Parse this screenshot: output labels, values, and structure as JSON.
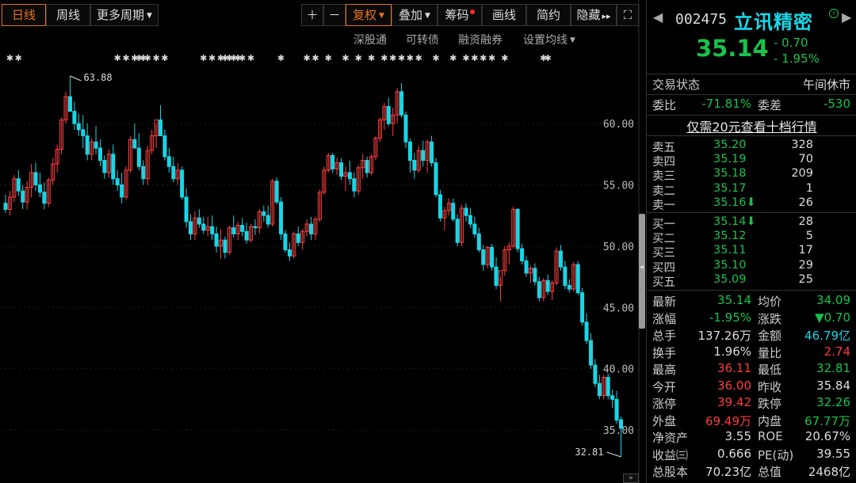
{
  "toolbar": {
    "period_day": "日线",
    "period_week": "周线",
    "period_more": "更多周期",
    "zoom_in": "＋",
    "zoom_out": "－",
    "adjust": "复权",
    "overlay": "叠加",
    "chips": "筹码",
    "draw": "画线",
    "simple": "简约",
    "hide": "隐藏",
    "hide_arrows": "▸▸",
    "fullscreen": "⛶"
  },
  "subbar": {
    "sz_connect": "深股通",
    "convertible": "可转债",
    "margin": "融资融券",
    "ma_settings": "设置均线"
  },
  "chart_data": {
    "type": "candlestick",
    "y_ticks": [
      "60.00",
      "55.00",
      "50.00",
      "45.00",
      "40.00",
      "35.00"
    ],
    "ylim": [
      32.0,
      66.0
    ],
    "high_label": "63.88",
    "low_label": "32.81",
    "colors": {
      "up": "#ff4040",
      "down": "#19d6e6"
    },
    "ohlc": [
      [
        53.5,
        54.2,
        52.7,
        53.0
      ],
      [
        53.0,
        54.5,
        52.5,
        54.0
      ],
      [
        54.0,
        55.8,
        53.6,
        55.5
      ],
      [
        55.5,
        56.2,
        54.1,
        54.5
      ],
      [
        54.5,
        55.0,
        53.0,
        53.6
      ],
      [
        53.6,
        55.3,
        53.0,
        54.8
      ],
      [
        54.8,
        56.7,
        54.0,
        56.0
      ],
      [
        56.0,
        56.8,
        54.5,
        55.0
      ],
      [
        55.0,
        56.0,
        54.0,
        54.4
      ],
      [
        54.4,
        55.2,
        53.0,
        53.5
      ],
      [
        53.5,
        55.6,
        53.2,
        55.4
      ],
      [
        55.4,
        57.2,
        55.0,
        56.7
      ],
      [
        56.7,
        58.3,
        56.0,
        57.9
      ],
      [
        57.9,
        60.5,
        57.5,
        60.3
      ],
      [
        60.3,
        62.6,
        60.0,
        62.2
      ],
      [
        62.2,
        63.88,
        61.0,
        61.0
      ],
      [
        61.0,
        61.8,
        59.5,
        60.0
      ],
      [
        60.0,
        60.8,
        59.0,
        59.5
      ],
      [
        59.5,
        60.7,
        58.0,
        59.0
      ],
      [
        59.0,
        60.0,
        57.0,
        57.5
      ],
      [
        57.5,
        58.8,
        57.0,
        58.5
      ],
      [
        58.5,
        59.8,
        57.5,
        58.0
      ],
      [
        58.0,
        58.7,
        56.5,
        57.0
      ],
      [
        57.0,
        57.4,
        55.5,
        56.0
      ],
      [
        56.0,
        57.9,
        55.6,
        57.5
      ],
      [
        57.5,
        58.3,
        55.0,
        55.5
      ],
      [
        55.5,
        56.2,
        54.5,
        55.0
      ],
      [
        55.0,
        56.0,
        53.5,
        54.0
      ],
      [
        54.0,
        56.5,
        53.8,
        56.2
      ],
      [
        56.2,
        59.0,
        56.0,
        58.7
      ],
      [
        58.7,
        60.0,
        58.2,
        58.0
      ],
      [
        58.0,
        59.2,
        56.2,
        56.5
      ],
      [
        56.5,
        57.0,
        55.0,
        55.5
      ],
      [
        55.5,
        58.2,
        55.0,
        57.8
      ],
      [
        57.8,
        59.5,
        57.5,
        59.0
      ],
      [
        59.0,
        60.0,
        58.0,
        60.3
      ],
      [
        60.3,
        61.5,
        59.0,
        59.0
      ],
      [
        59.0,
        59.5,
        57.0,
        57.3
      ],
      [
        57.3,
        58.0,
        56.0,
        56.5
      ],
      [
        56.5,
        57.3,
        55.2,
        55.5
      ],
      [
        55.5,
        56.8,
        55.0,
        56.2
      ],
      [
        56.2,
        56.5,
        53.8,
        54.0
      ],
      [
        54.0,
        54.7,
        51.5,
        52.0
      ],
      [
        52.0,
        52.6,
        50.5,
        51.0
      ],
      [
        51.0,
        52.8,
        50.5,
        52.3
      ],
      [
        52.3,
        53.0,
        51.5,
        51.8
      ],
      [
        51.8,
        52.4,
        51.0,
        51.3
      ],
      [
        51.3,
        52.4,
        50.8,
        51.6
      ],
      [
        51.6,
        52.5,
        50.5,
        51.0
      ],
      [
        51.0,
        51.6,
        49.5,
        50.0
      ],
      [
        50.0,
        51.4,
        49.0,
        50.5
      ],
      [
        50.5,
        50.8,
        49.0,
        49.5
      ],
      [
        49.5,
        51.7,
        49.3,
        51.5
      ],
      [
        51.5,
        52.5,
        50.7,
        51.0
      ],
      [
        51.0,
        52.0,
        50.5,
        51.7
      ],
      [
        51.7,
        52.3,
        50.8,
        51.2
      ],
      [
        51.2,
        51.9,
        50.2,
        50.5
      ],
      [
        50.5,
        51.8,
        50.3,
        51.6
      ],
      [
        51.6,
        52.2,
        50.9,
        51.5
      ],
      [
        51.5,
        53.0,
        51.0,
        52.8
      ],
      [
        52.8,
        53.3,
        52.0,
        52.5
      ],
      [
        52.5,
        53.3,
        51.5,
        51.8
      ],
      [
        51.8,
        55.5,
        51.6,
        55.3
      ],
      [
        55.3,
        55.6,
        53.4,
        53.6
      ],
      [
        53.6,
        54.0,
        50.5,
        51.0
      ],
      [
        51.0,
        51.3,
        49.5,
        49.7
      ],
      [
        49.7,
        50.3,
        48.8,
        49.2
      ],
      [
        49.2,
        51.2,
        49.0,
        51.0
      ],
      [
        51.0,
        51.6,
        50.0,
        50.3
      ],
      [
        50.3,
        51.4,
        49.7,
        51.2
      ],
      [
        51.2,
        52.2,
        50.8,
        51.8
      ],
      [
        51.8,
        52.4,
        50.5,
        51.0
      ],
      [
        51.0,
        52.4,
        50.5,
        52.2
      ],
      [
        52.2,
        54.6,
        52.0,
        54.4
      ],
      [
        54.4,
        56.5,
        54.2,
        56.2
      ],
      [
        56.2,
        57.6,
        56.0,
        57.4
      ],
      [
        57.4,
        57.6,
        56.0,
        56.3
      ],
      [
        56.3,
        57.2,
        55.8,
        56.8
      ],
      [
        56.8,
        57.2,
        55.4,
        55.7
      ],
      [
        55.7,
        56.5,
        54.5,
        56.0
      ],
      [
        56.0,
        57.0,
        55.0,
        55.5
      ],
      [
        55.5,
        56.0,
        54.0,
        54.5
      ],
      [
        54.5,
        56.6,
        54.2,
        56.4
      ],
      [
        56.4,
        57.5,
        55.5,
        57.0
      ],
      [
        57.0,
        57.3,
        55.6,
        56.0
      ],
      [
        56.0,
        57.5,
        55.8,
        57.3
      ],
      [
        57.3,
        59.0,
        57.0,
        58.8
      ],
      [
        58.8,
        60.5,
        58.5,
        60.3
      ],
      [
        60.3,
        61.7,
        59.5,
        61.4
      ],
      [
        61.4,
        62.1,
        59.8,
        60.0
      ],
      [
        60.0,
        61.3,
        59.0,
        60.7
      ],
      [
        60.7,
        62.9,
        60.0,
        62.6
      ],
      [
        62.6,
        63.3,
        60.5,
        60.7
      ],
      [
        60.7,
        61.0,
        58.0,
        58.5
      ],
      [
        58.5,
        58.8,
        56.0,
        57.0
      ],
      [
        57.0,
        57.6,
        55.5,
        56.2
      ],
      [
        56.2,
        58.2,
        56.0,
        57.8
      ],
      [
        57.8,
        58.6,
        56.5,
        57.0
      ],
      [
        57.0,
        58.7,
        56.0,
        58.5
      ],
      [
        58.5,
        59.0,
        56.5,
        56.8
      ],
      [
        56.8,
        57.2,
        54.0,
        54.2
      ],
      [
        54.2,
        54.6,
        52.0,
        52.3
      ],
      [
        52.3,
        53.2,
        51.3,
        52.9
      ],
      [
        52.9,
        53.9,
        52.5,
        53.5
      ],
      [
        53.5,
        53.9,
        52.0,
        52.2
      ],
      [
        52.2,
        52.6,
        50.0,
        50.3
      ],
      [
        50.3,
        53.4,
        50.0,
        53.1
      ],
      [
        53.1,
        53.5,
        52.0,
        52.5
      ],
      [
        52.5,
        53.1,
        51.5,
        51.8
      ],
      [
        51.8,
        52.4,
        50.7,
        51.0
      ],
      [
        51.0,
        51.5,
        49.5,
        49.7
      ],
      [
        49.7,
        50.1,
        48.0,
        48.5
      ],
      [
        48.5,
        50.0,
        48.2,
        49.9
      ],
      [
        49.9,
        50.2,
        48.0,
        48.3
      ],
      [
        48.3,
        49.1,
        46.5,
        46.8
      ],
      [
        46.8,
        47.5,
        45.5,
        48.0
      ],
      [
        48.0,
        50.0,
        47.6,
        49.7
      ],
      [
        49.7,
        50.3,
        48.5,
        50.0
      ],
      [
        50.0,
        53.2,
        49.8,
        53.0
      ],
      [
        53.0,
        53.1,
        49.5,
        49.8
      ],
      [
        49.8,
        50.2,
        48.5,
        48.8
      ],
      [
        48.8,
        49.2,
        47.5,
        47.8
      ],
      [
        47.8,
        48.4,
        47.0,
        48.2
      ],
      [
        48.2,
        48.6,
        46.8,
        47.1
      ],
      [
        47.1,
        47.5,
        45.5,
        45.8
      ],
      [
        45.8,
        47.4,
        45.5,
        47.2
      ],
      [
        47.2,
        47.7,
        46.0,
        46.3
      ],
      [
        46.3,
        47.2,
        45.6,
        47.0
      ],
      [
        47.0,
        49.9,
        46.8,
        49.6
      ],
      [
        49.6,
        50.1,
        48.0,
        48.3
      ],
      [
        48.3,
        48.8,
        46.5,
        46.8
      ],
      [
        46.8,
        47.3,
        46.2,
        46.5
      ],
      [
        46.5,
        48.7,
        46.3,
        48.5
      ],
      [
        48.5,
        48.8,
        46.0,
        46.2
      ],
      [
        46.2,
        46.6,
        43.5,
        43.8
      ],
      [
        43.8,
        44.5,
        42.0,
        42.3
      ],
      [
        42.3,
        42.9,
        40.0,
        40.3
      ],
      [
        40.3,
        40.8,
        38.5,
        38.8
      ],
      [
        38.8,
        39.5,
        37.5,
        37.8
      ],
      [
        37.8,
        39.5,
        37.5,
        39.3
      ],
      [
        39.3,
        39.6,
        37.5,
        37.8
      ],
      [
        37.8,
        38.3,
        36.8,
        37.5
      ],
      [
        37.5,
        38.2,
        35.5,
        35.8
      ],
      [
        35.84,
        36.11,
        32.81,
        35.14
      ]
    ]
  },
  "quote": {
    "code": "002475",
    "name": "立讯精密",
    "price": "35.14",
    "change": "- 0.70",
    "change_pct": "- 1.95%",
    "status_label": "交易状态",
    "status_value": "午间休市",
    "weibi_label": "委比",
    "weibi_value": "-71.81%",
    "weicha_label": "委差",
    "weicha_value": "-530",
    "ten_level": "仅需20元查看十档行情",
    "asks": [
      {
        "label": "卖五",
        "price": "35.20",
        "vol": "328"
      },
      {
        "label": "卖四",
        "price": "35.19",
        "vol": "70"
      },
      {
        "label": "卖三",
        "price": "35.18",
        "vol": "209"
      },
      {
        "label": "卖二",
        "price": "35.17",
        "vol": "1"
      },
      {
        "label": "卖一",
        "price": "35.16⬇",
        "vol": "26"
      }
    ],
    "bids": [
      {
        "label": "买一",
        "price": "35.14⬇",
        "vol": "28"
      },
      {
        "label": "买二",
        "price": "35.12",
        "vol": "5"
      },
      {
        "label": "买三",
        "price": "35.11",
        "vol": "17"
      },
      {
        "label": "买四",
        "price": "35.10",
        "vol": "29"
      },
      {
        "label": "买五",
        "price": "35.09",
        "vol": "25"
      }
    ],
    "stats": [
      {
        "l1": "最新",
        "v1": "35.14",
        "c1": "g",
        "l2": "均价",
        "v2": "34.09",
        "c2": "g"
      },
      {
        "l1": "涨幅",
        "v1": "-1.95%",
        "c1": "g",
        "l2": "涨跌",
        "v2": "▼0.70",
        "c2": "g"
      },
      {
        "l1": "总手",
        "v1": "137.26万",
        "c1": "w",
        "l2": "金额",
        "v2": "46.79亿",
        "c2": "c"
      },
      {
        "l1": "换手",
        "v1": "1.96%",
        "c1": "w",
        "l2": "量比",
        "v2": "2.74",
        "c2": "r"
      },
      {
        "l1": "最高",
        "v1": "36.11",
        "c1": "r",
        "l2": "最低",
        "v2": "32.81",
        "c2": "g"
      },
      {
        "l1": "今开",
        "v1": "36.00",
        "c1": "r",
        "l2": "昨收",
        "v2": "35.84",
        "c2": "w"
      },
      {
        "l1": "涨停",
        "v1": "39.42",
        "c1": "r",
        "l2": "跌停",
        "v2": "32.26",
        "c2": "g"
      },
      {
        "l1": "外盘",
        "v1": "69.49万",
        "c1": "r",
        "l2": "内盘",
        "v2": "67.77万",
        "c2": "g"
      },
      {
        "l1": "净资产",
        "v1": "3.55",
        "c1": "w",
        "l2": "ROE",
        "v2": "20.67%",
        "c2": "w"
      },
      {
        "l1": "收益㈢",
        "v1": "0.666",
        "c1": "w",
        "l2": "PE(动)",
        "v2": "39.55",
        "c2": "w"
      },
      {
        "l1": "总股本",
        "v1": "70.23亿",
        "c1": "w",
        "l2": "总值",
        "v2": "2468亿",
        "c2": "w"
      }
    ]
  }
}
